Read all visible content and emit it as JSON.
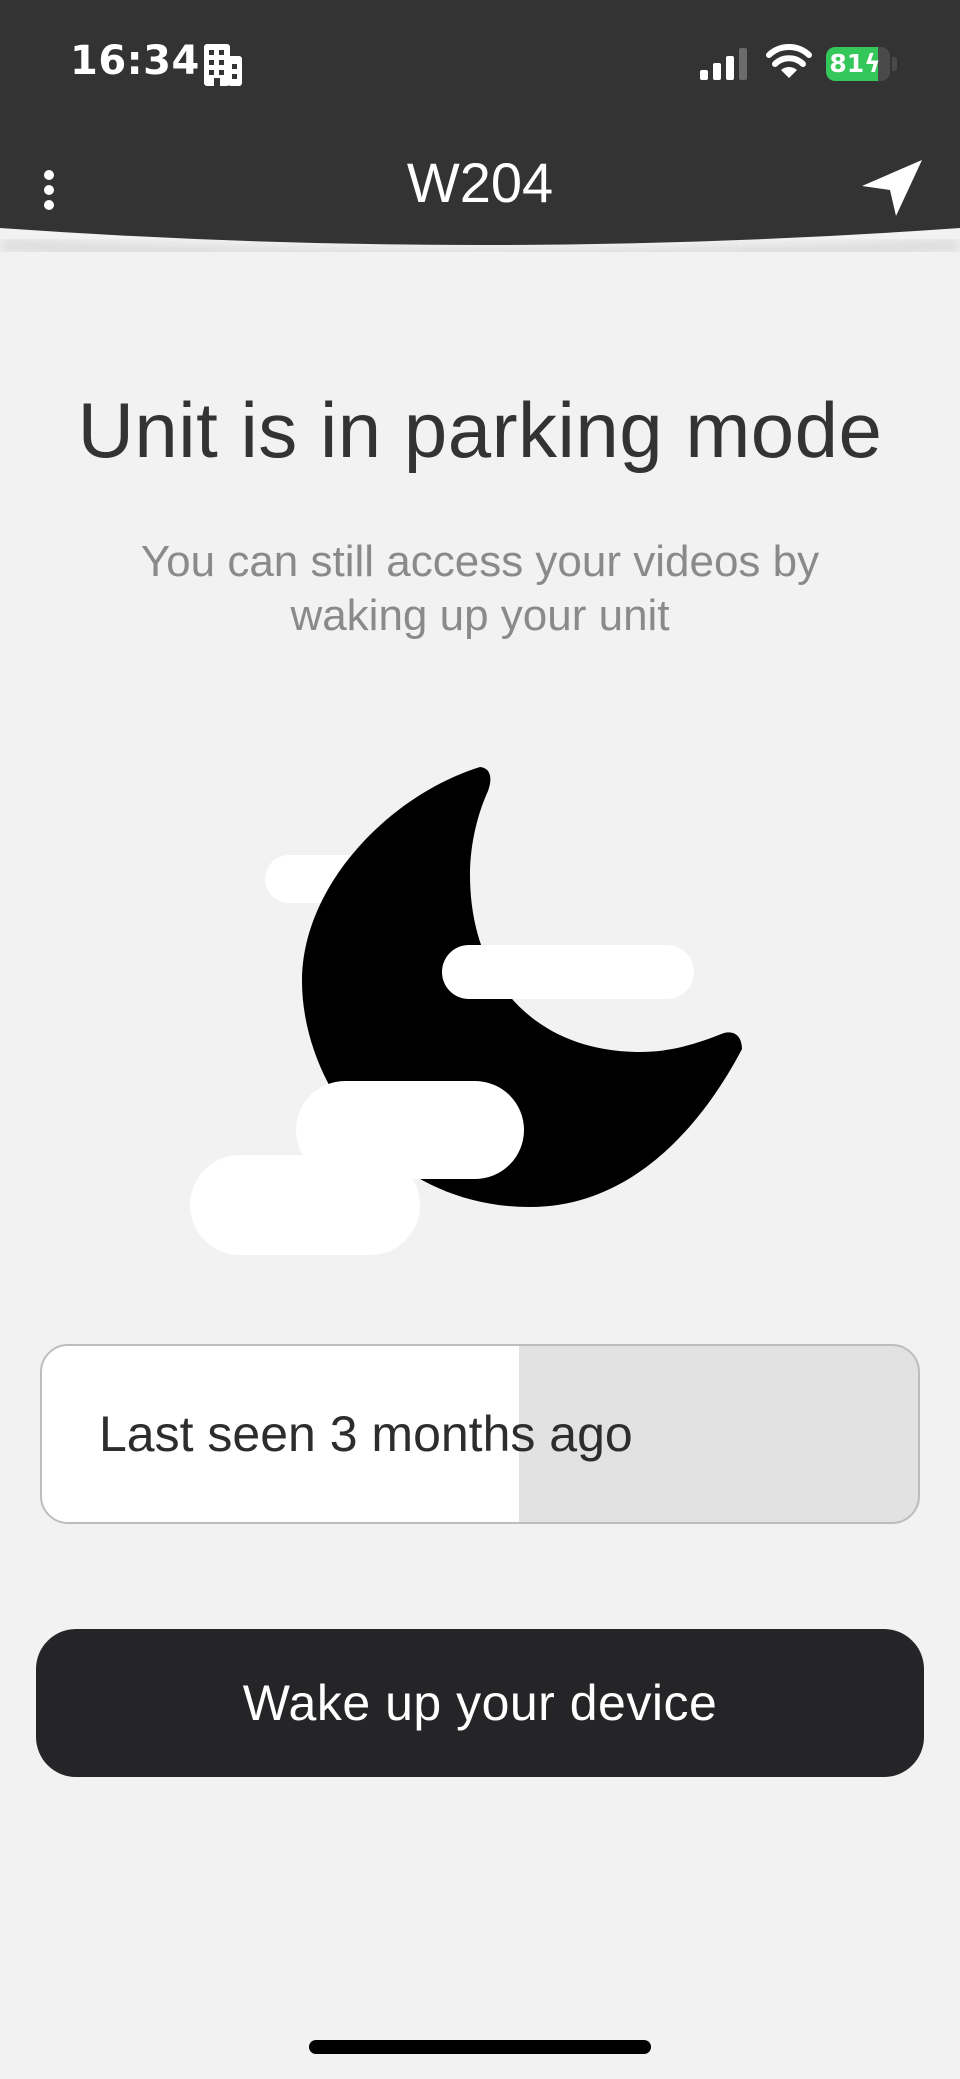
{
  "status_bar": {
    "time": "16:34",
    "battery_percent": "81",
    "battery_level": 0.81,
    "battery_color": "#34c759",
    "icons": [
      "building-icon",
      "cellular-signal-icon",
      "wifi-icon",
      "battery-charging-icon"
    ]
  },
  "header": {
    "title": "W204",
    "menu_icon": "vertical-dots-icon",
    "action_icon": "navigation-arrow-icon",
    "background": "#333333"
  },
  "main": {
    "headline": "Unit is in parking mode",
    "subtext": "You can still access your videos by waking up your unit",
    "illustration_icon": "moon-clouds-icon",
    "last_seen": {
      "label": "Last seen 3 months ago",
      "progress": 0.545
    },
    "wake_button_label": "Wake up your device"
  }
}
